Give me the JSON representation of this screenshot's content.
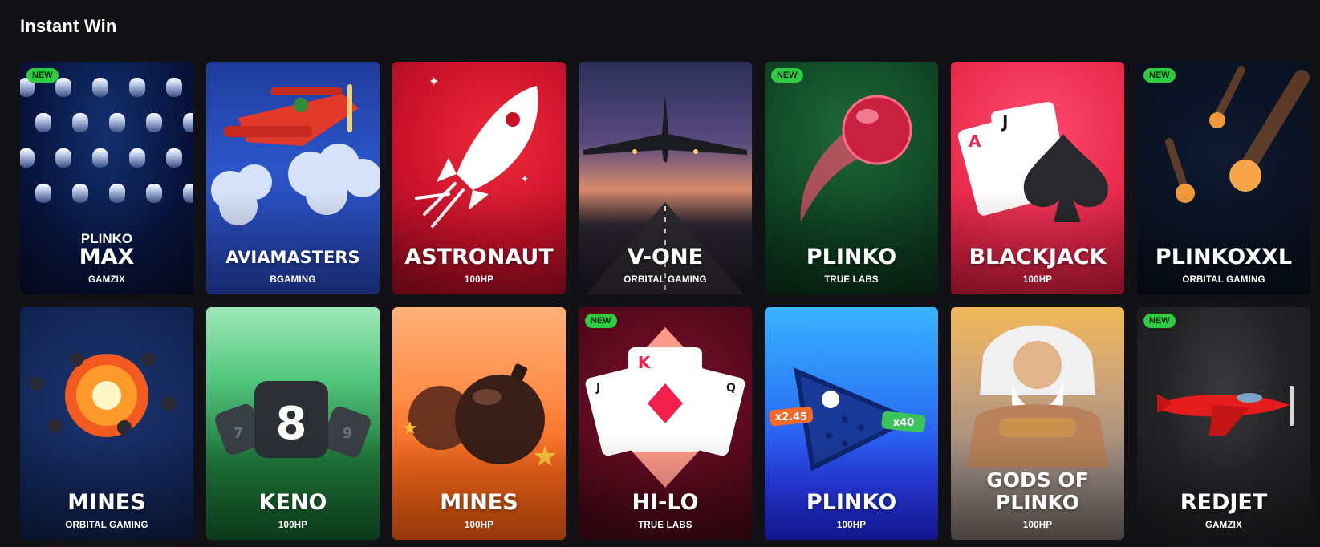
{
  "section": {
    "title": "Instant Win"
  },
  "games": [
    {
      "pre": "PLINKO",
      "name": "MAX",
      "provider": "GAMZIX",
      "badge": "NEW"
    },
    {
      "name": "AVIAMASTERS",
      "provider": "BGAMING"
    },
    {
      "name": "ASTRONAUT",
      "provider": "100HP"
    },
    {
      "name": "V-ONE",
      "provider": "ORBITAL GAMING"
    },
    {
      "name": "PLINKO",
      "provider": "TRUE LABS",
      "badge": "NEW"
    },
    {
      "name": "BLACKJACK",
      "provider": "100HP"
    },
    {
      "name": "PLINKOXXL",
      "provider": "ORBITAL GAMING",
      "badge": "NEW"
    },
    {
      "name": "MINES",
      "provider": "ORBITAL GAMING"
    },
    {
      "name": "KENO",
      "provider": "100HP"
    },
    {
      "name": "MINES",
      "provider": "100HP"
    },
    {
      "name": "HI-LO",
      "provider": "TRUE LABS",
      "badge": "NEW"
    },
    {
      "name": "PLINKO",
      "provider": "100HP",
      "art": {
        "left_chip": "x2.45",
        "right_chip": "x40"
      }
    },
    {
      "name": "GODS OF PLINKO",
      "provider": "100HP"
    },
    {
      "name": "REDJET",
      "provider": "GAMZIX",
      "badge": "NEW"
    }
  ],
  "art_text": {
    "keno": {
      "main": "8",
      "left": "7",
      "right": "9"
    },
    "hilo": {
      "center": "K",
      "left": "J",
      "right": "Q"
    },
    "blackjack": {
      "front": "J",
      "back": "A"
    }
  }
}
